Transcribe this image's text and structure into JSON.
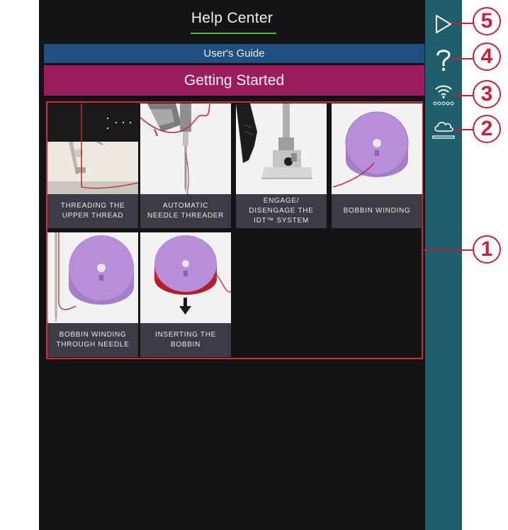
{
  "header": {
    "title": "Help Center"
  },
  "guide_bar": {
    "label": "User's Guide"
  },
  "section_bar": {
    "label": "Getting Started"
  },
  "topics": [
    {
      "lines": [
        "THREADING THE",
        "UPPER THREAD"
      ]
    },
    {
      "lines": [
        "AUTOMATIC",
        "NEEDLE THREADER"
      ]
    },
    {
      "lines": [
        "ENGAGE/",
        "DISENGAGE THE",
        "IDT™ SYSTEM"
      ]
    },
    {
      "lines": [
        "BOBBIN WINDING"
      ]
    },
    {
      "lines": [
        "BOBBIN WINDING",
        "THROUGH NEEDLE"
      ]
    },
    {
      "lines": [
        "INSERTING THE",
        "BOBBIN"
      ]
    }
  ],
  "rail": {
    "icons": [
      "play-icon",
      "help-icon",
      "wifi-icon",
      "cloud-icon"
    ]
  },
  "callouts": [
    "5",
    "4",
    "3",
    "2",
    "1"
  ],
  "colors": {
    "header_accent": "#56b848",
    "guide_bar": "#1f4f7e",
    "section_bar": "#9c1d5e",
    "rail": "#1f5e6a",
    "callout": "#c7213a",
    "caption_bg": "#3c3c44"
  }
}
